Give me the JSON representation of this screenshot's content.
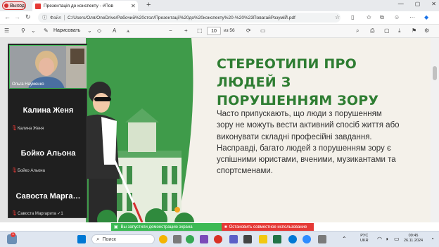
{
  "browser": {
    "exit_label": "Выход",
    "tab_title": "Презентація до конспекту - #Пов",
    "new_tab": "+",
    "window_controls": [
      "—",
      "▢",
      "✕"
    ]
  },
  "address": {
    "file_label": "Файл",
    "url": "C:/Users/Оля/OneDrive/Рабочий%20стол/Презентації%20до%20конспекту%20-%20%23ПовагайРозуміЙ.pdf"
  },
  "pdf_toolbar": {
    "draw_label": "Нарисовать",
    "page_current": "10",
    "page_of": "из 56"
  },
  "slide": {
    "title": "СТЕРЕОТИПИ ПРО ЛЮДЕЙ З ПОРУШЕННЯМ ЗОРУ",
    "body": "Часто припускають, що люди з порушенням зору не можуть вести активний спосіб життя або виконувати складні професійні завдання. Насправді, багато людей з порушенням зору є успішними юристами, вченими, музикантами та спортсменами.",
    "colors": {
      "title": "#2e7d32",
      "background": "#f4f1ea",
      "accent_green": "#3f9b4a"
    }
  },
  "meeting": {
    "video_name": "Ольга Науменко",
    "participants": [
      {
        "display": "Калина Женя",
        "label": "Калина Женя"
      },
      {
        "display": "Бойко Альона",
        "label": "Бойко Альона"
      },
      {
        "display": "Савоста Марга…",
        "label": "Савоста Маргарита ✓1"
      }
    ]
  },
  "share_banner": {
    "sharing_text": "Вы запустили демонстрацию экрана",
    "stop_text": "Остановить совместное использование"
  },
  "taskbar": {
    "notification_count": "1",
    "search_placeholder": "Поиск",
    "lang_top": "РУС",
    "lang_bottom": "UKR",
    "time": "09:45",
    "date": "26.11.2024"
  }
}
